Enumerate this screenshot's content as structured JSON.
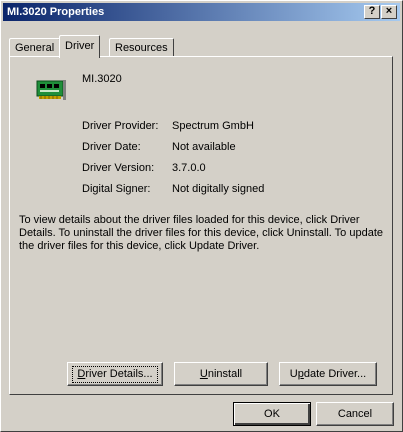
{
  "window": {
    "title": "MI.3020 Properties",
    "help_glyph": "?",
    "close_glyph": "×"
  },
  "tabs": [
    {
      "label": "General"
    },
    {
      "label": "Driver"
    },
    {
      "label": "Resources"
    }
  ],
  "device": {
    "name": "MI.3020",
    "icon": "pci-card-icon"
  },
  "properties": [
    {
      "label": "Driver Provider:",
      "value": "Spectrum GmbH"
    },
    {
      "label": "Driver Date:",
      "value": "Not available"
    },
    {
      "label": "Driver Version:",
      "value": "3.7.0.0"
    },
    {
      "label": "Digital Signer:",
      "value": "Not digitally signed"
    }
  ],
  "description": "To view details about the driver files loaded for this device, click Driver Details. To uninstall the driver files for this device, click Uninstall. To update the driver files for this device, click Update Driver.",
  "buttons": {
    "driver_details": {
      "mnemonic": "D",
      "rest": "river Details..."
    },
    "uninstall": {
      "mnemonic": "U",
      "rest": "ninstall"
    },
    "update_driver": {
      "pre": "U",
      "mnemonic": "p",
      "rest": "date Driver..."
    },
    "ok": "OK",
    "cancel": "Cancel"
  },
  "colors": {
    "title_gradient_start": "#0a246a",
    "title_gradient_end": "#a6caf0",
    "face": "#d4d0c8",
    "icon_green": "#1f8f3a"
  }
}
